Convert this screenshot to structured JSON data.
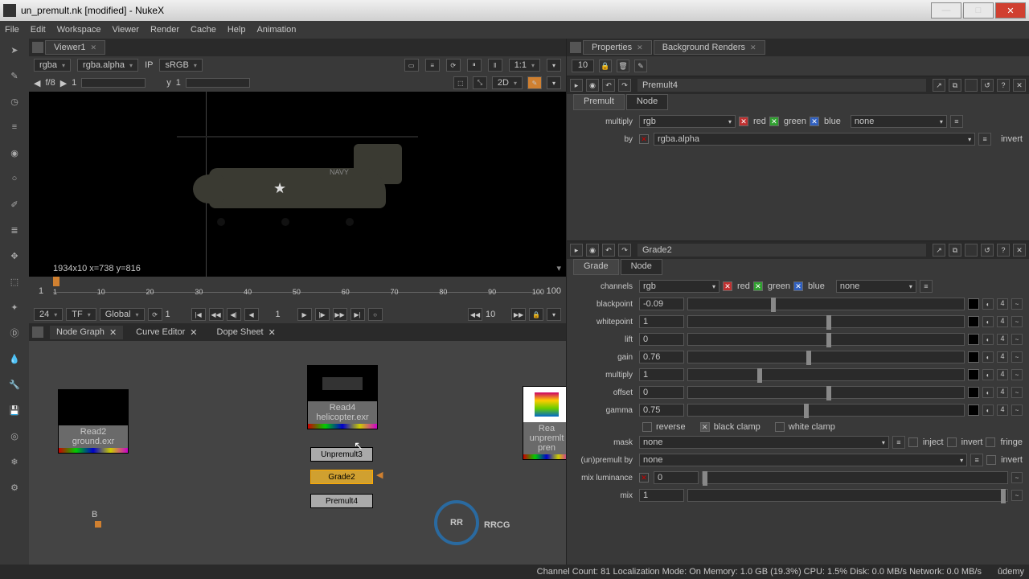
{
  "window": {
    "title": "un_premult.nk [modified] - NukeX"
  },
  "menus": [
    "File",
    "Edit",
    "Workspace",
    "Viewer",
    "Render",
    "Cache",
    "Help",
    "Animation"
  ],
  "viewer": {
    "tab": "Viewer1",
    "channel": "rgba",
    "alpha": "rgba.alpha",
    "lut": "sRGB",
    "ratio": "1:1",
    "fstop": "f/8",
    "frame": "1",
    "y": "1",
    "mode2d": "2D",
    "coords": "1934x10  x=738 y=816",
    "ip": "IP",
    "navy": "NAVY"
  },
  "timeline": {
    "start": "1",
    "end": "100",
    "ticks": [
      "1",
      "10",
      "20",
      "30",
      "40",
      "50",
      "60",
      "70",
      "80",
      "90",
      "100"
    ]
  },
  "playbar": {
    "fps": "24",
    "tf": "TF",
    "scope": "Global",
    "cur": "1",
    "step": "10"
  },
  "nodegraph": {
    "tabs": [
      "Node Graph",
      "Curve Editor",
      "Dope Sheet"
    ],
    "read2": {
      "name": "Read2",
      "file": "ground.exr"
    },
    "read4": {
      "name": "Read4",
      "file": "helicopter.exr"
    },
    "read5": {
      "name": "Rea",
      "file": "unpremlt pren"
    },
    "unpremult": "Unpremult3",
    "grade": "Grade2",
    "premult": "Premult4",
    "b": "B"
  },
  "properties": {
    "tabs": [
      "Properties",
      "Background Renders"
    ],
    "count": "10"
  },
  "premult4": {
    "name": "Premult4",
    "tabs": [
      "Premult",
      "Node"
    ],
    "multiply": "rgb",
    "by": "rgba.alpha",
    "mask_none": "none",
    "red": "red",
    "green": "green",
    "blue": "blue",
    "invert": "invert"
  },
  "grade2": {
    "name": "Grade2",
    "tabs": [
      "Grade",
      "Node"
    ],
    "channels": "rgb",
    "blackpoint": "-0.09",
    "whitepoint": "1",
    "lift": "0",
    "gain": "0.76",
    "multiply": "1",
    "offset": "0",
    "gamma": "0.75",
    "reverse": "reverse",
    "blackclamp": "black clamp",
    "whiteclamp": "white clamp",
    "mask": "none",
    "inject": "inject",
    "invert": "invert",
    "fringe": "fringe",
    "unpremult": "none",
    "invert2": "invert",
    "mixlum": "0",
    "mix": "1",
    "red": "red",
    "green": "green",
    "blue": "blue",
    "none": "none",
    "four": "4"
  },
  "labels": {
    "multiply": "multiply",
    "by": "by",
    "channels": "channels",
    "blackpoint": "blackpoint",
    "whitepoint": "whitepoint",
    "lift": "lift",
    "gain": "gain",
    "offset": "offset",
    "gamma": "gamma",
    "mask": "mask",
    "unpremult": "(un)premult by",
    "mixlum": "mix luminance",
    "mix": "mix"
  },
  "status": "Channel Count: 81 Localization Mode: On Memory: 1.0 GB (19.3%) CPU: 1.5% Disk: 0.0 MB/s Network: 0.0 MB/s",
  "udemy": "ûdemy",
  "logo": {
    "r": "RR",
    "t": "RRCG"
  }
}
